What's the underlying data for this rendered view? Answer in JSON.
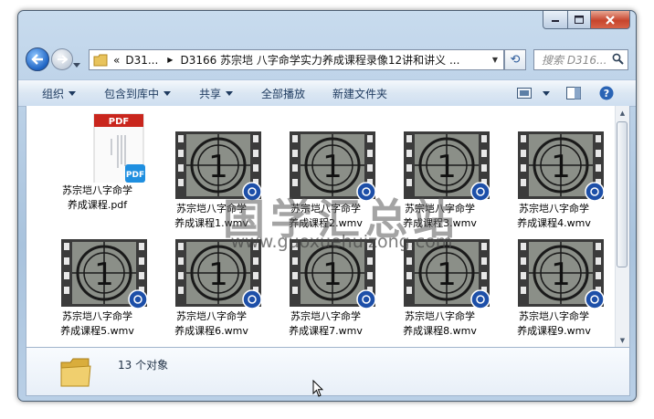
{
  "window": {
    "address_prefix": "«",
    "breadcrumb_1": "D31...",
    "breadcrumb_2": "D3166 苏宗垲 八字命学实力养成课程录像12讲和讲义 ...",
    "search_placeholder": "搜索 D316..."
  },
  "toolbar": {
    "organize": "组织",
    "include_library": "包含到库中",
    "share": "共享",
    "play_all": "全部播放",
    "new_folder": "新建文件夹"
  },
  "watermark": {
    "text": "国学汇总站",
    "url": "www.guoxuehuizong.com"
  },
  "pdf_label": "PDF",
  "files": [
    {
      "line1": "苏宗垲八字命学",
      "line2": "养成课程.pdf",
      "type": "pdf"
    },
    {
      "line1": "苏宗垲八字命学",
      "line2": "养成课程1.wmv",
      "type": "wmv"
    },
    {
      "line1": "苏宗垲八字命学",
      "line2": "养成课程2.wmv",
      "type": "wmv"
    },
    {
      "line1": "苏宗垲八字命学",
      "line2": "养成课程3.wmv",
      "type": "wmv"
    },
    {
      "line1": "苏宗垲八字命学",
      "line2": "养成课程4.wmv",
      "type": "wmv"
    },
    {
      "line1": "苏宗垲八字命学",
      "line2": "养成课程5.wmv",
      "type": "wmv"
    },
    {
      "line1": "苏宗垲八字命学",
      "line2": "养成课程6.wmv",
      "type": "wmv"
    },
    {
      "line1": "苏宗垲八字命学",
      "line2": "养成课程7.wmv",
      "type": "wmv"
    },
    {
      "line1": "苏宗垲八字命学",
      "line2": "养成课程8.wmv",
      "type": "wmv"
    },
    {
      "line1": "苏宗垲八字命学",
      "line2": "养成课程9.wmv",
      "type": "wmv"
    }
  ],
  "film_leader_number": "1",
  "details": {
    "count": "13 个对象"
  },
  "icons": [
    "back-arrow-icon",
    "forward-arrow-icon",
    "folder-icon",
    "refresh-icon",
    "search-icon",
    "view-icon",
    "preview-pane-icon",
    "help-icon",
    "pdf-icon",
    "video-icon",
    "media-player-icon"
  ],
  "colors": {
    "accent": "#1e64c4",
    "close": "#c7452d",
    "chrome": "#b9cfe6"
  }
}
